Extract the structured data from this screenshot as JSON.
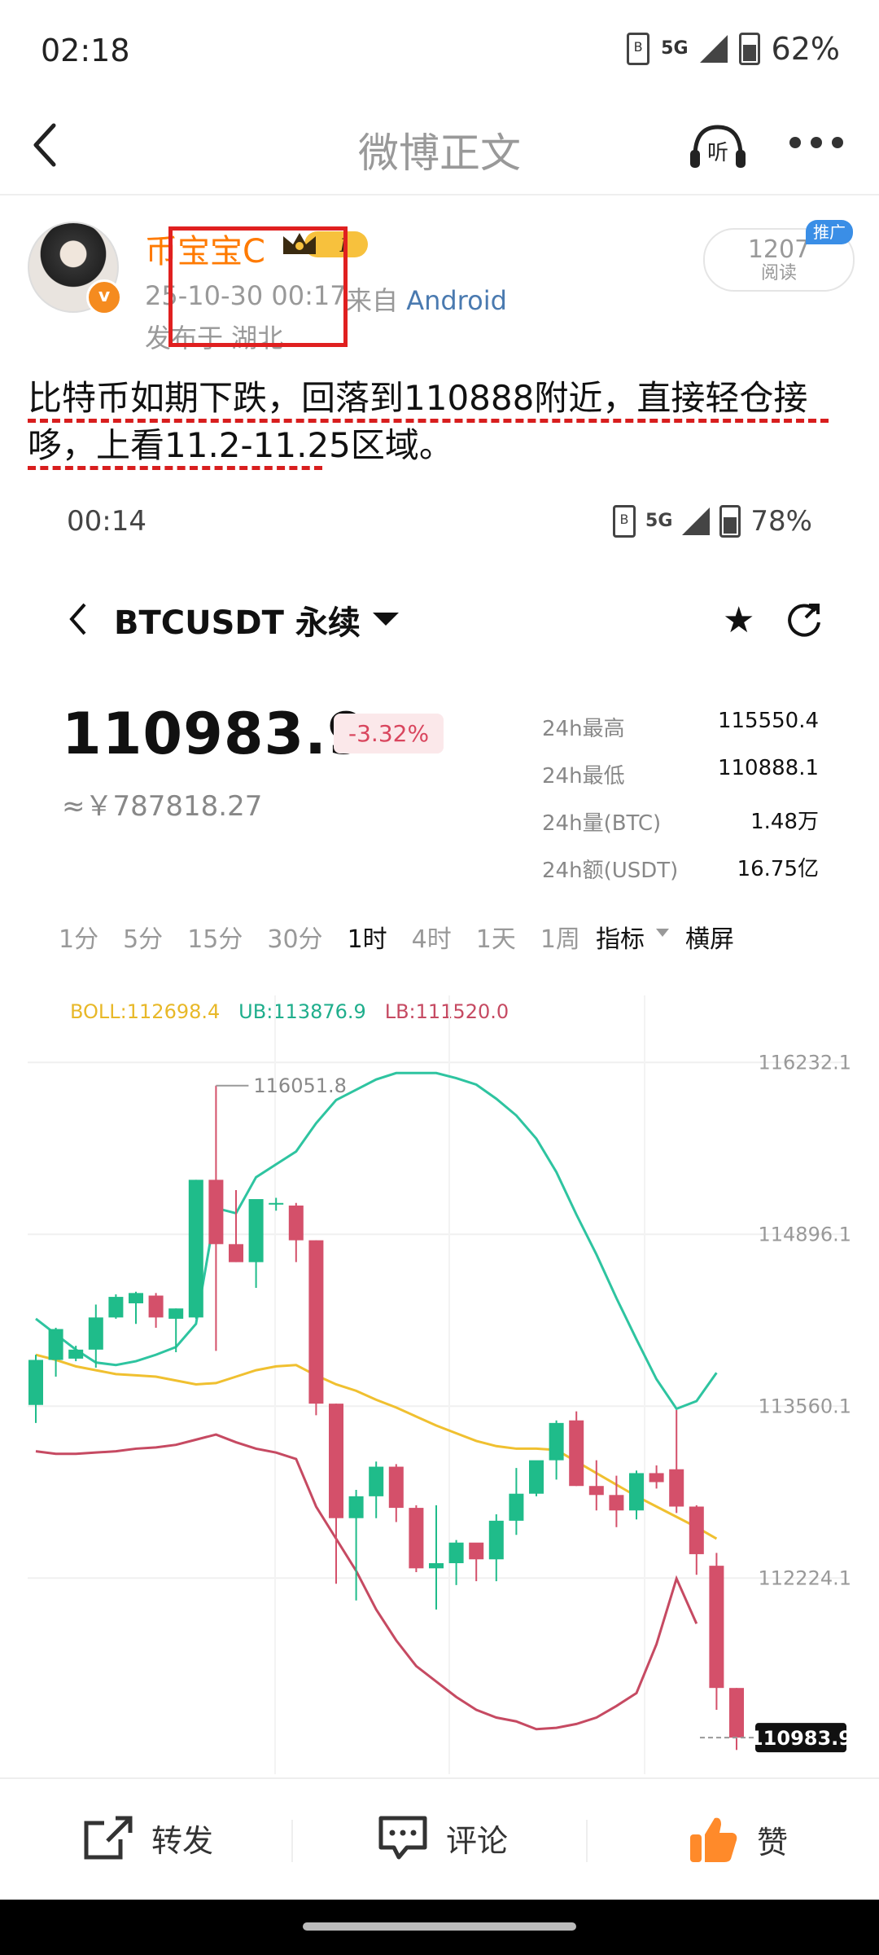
{
  "status": {
    "time": "02:18",
    "network": "5G",
    "battery": "62%"
  },
  "header": {
    "title": "微博正文"
  },
  "author": {
    "name": "币宝宝C",
    "date": "25-10-30 00:17",
    "source_prefix": "来自",
    "source": "Android",
    "location": "发布于 湖北",
    "reads": "1207",
    "reads_label": "阅读",
    "promo": "推广",
    "vip_level": "I"
  },
  "post": {
    "text": "比特币如期下跌，回落到110888附近，直接轻仓接哆，上看11.2-11.25区域。"
  },
  "embedded": {
    "status": {
      "time": "00:14",
      "network": "5G",
      "battery": "78%"
    },
    "symbol": "BTCUSDT 永续",
    "price": "110983.9",
    "change": "-3.32%",
    "cny": "≈￥787818.27",
    "stats": [
      {
        "label": "24h最高",
        "value": "115550.4"
      },
      {
        "label": "24h最低",
        "value": "110888.1"
      },
      {
        "label": "24h量(BTC)",
        "value": "1.48万"
      },
      {
        "label": "24h额(USDT)",
        "value": "16.75亿"
      }
    ],
    "periods": [
      "1分",
      "5分",
      "15分",
      "30分",
      "1时",
      "4时",
      "1天",
      "1周"
    ],
    "active_period": "1时",
    "indicator": "指标",
    "landscape": "横屏",
    "boll": {
      "boll": "BOLL:112698.4",
      "ub": "UB:113876.9",
      "lb": "LB:111520.0"
    }
  },
  "chart_data": {
    "type": "candlestick",
    "ylim": [
      110700,
      116500
    ],
    "y_ticks": [
      "116232.1",
      "114896.1",
      "113560.1",
      "112224.1"
    ],
    "y_tick_values": [
      116232.1,
      114896.1,
      113560.1,
      112224.1
    ],
    "high_annotation": "116051.8",
    "last_price_label": "110983.9",
    "colors": {
      "up": "#1fbc8a",
      "down": "#d4506a",
      "boll_mid": "#f0c030",
      "boll_upper": "#2ec4a0",
      "boll_lower": "#c64a62"
    },
    "candles": [
      {
        "o": 113570,
        "h": 113960,
        "c": 113920,
        "l": 113430
      },
      {
        "o": 113920,
        "h": 114170,
        "c": 114160,
        "l": 113790
      },
      {
        "o": 113930,
        "h": 114030,
        "c": 114000,
        "l": 113910
      },
      {
        "o": 114000,
        "h": 114350,
        "c": 114250,
        "l": 113860
      },
      {
        "o": 114250,
        "h": 114430,
        "c": 114410,
        "l": 114240
      },
      {
        "o": 114360,
        "h": 114450,
        "c": 114440,
        "l": 114200
      },
      {
        "o": 114420,
        "h": 114440,
        "c": 114250,
        "l": 114170
      },
      {
        "o": 114240,
        "h": 114320,
        "c": 114320,
        "l": 113980
      },
      {
        "o": 114250,
        "h": 115320,
        "c": 115320,
        "l": 114240
      },
      {
        "o": 115320,
        "h": 116051.8,
        "c": 114820,
        "l": 113990
      },
      {
        "o": 114820,
        "h": 115240,
        "c": 114680,
        "l": 114680
      },
      {
        "o": 114680,
        "h": 115120,
        "c": 115170,
        "l": 114480
      },
      {
        "o": 115140,
        "h": 115180,
        "c": 115140,
        "l": 115080
      },
      {
        "o": 115120,
        "h": 115140,
        "c": 114850,
        "l": 114680
      },
      {
        "o": 114850,
        "h": 114850,
        "c": 113580,
        "l": 113490
      },
      {
        "o": 113580,
        "h": 113580,
        "c": 112690,
        "l": 112180
      },
      {
        "o": 112690,
        "h": 112910,
        "c": 112860,
        "l": 112050
      },
      {
        "o": 112860,
        "h": 113130,
        "c": 113090,
        "l": 112690
      },
      {
        "o": 113090,
        "h": 113110,
        "c": 112770,
        "l": 112660
      },
      {
        "o": 112770,
        "h": 112790,
        "c": 112300,
        "l": 112270
      },
      {
        "o": 112300,
        "h": 112790,
        "c": 112340,
        "l": 111980
      },
      {
        "o": 112340,
        "h": 112520,
        "c": 112500,
        "l": 112170
      },
      {
        "o": 112500,
        "h": 112480,
        "c": 112370,
        "l": 112200
      },
      {
        "o": 112370,
        "h": 112720,
        "c": 112670,
        "l": 112200
      },
      {
        "o": 112670,
        "h": 113080,
        "c": 112880,
        "l": 112560
      },
      {
        "o": 112880,
        "h": 113120,
        "c": 113140,
        "l": 112860
      },
      {
        "o": 113140,
        "h": 113450,
        "c": 113430,
        "l": 112990
      },
      {
        "o": 113450,
        "h": 113520,
        "c": 112940,
        "l": 112940
      },
      {
        "o": 112940,
        "h": 113140,
        "c": 112870,
        "l": 112750
      },
      {
        "o": 112870,
        "h": 113020,
        "c": 112750,
        "l": 112620
      },
      {
        "o": 112750,
        "h": 113060,
        "c": 113040,
        "l": 112680
      },
      {
        "o": 113040,
        "h": 113100,
        "c": 112970,
        "l": 112920
      },
      {
        "o": 113070,
        "h": 113530,
        "c": 112780,
        "l": 112730
      },
      {
        "o": 112780,
        "h": 112790,
        "c": 112410,
        "l": 112250
      },
      {
        "o": 112320,
        "h": 112420,
        "c": 111370,
        "l": 111200
      },
      {
        "o": 111370,
        "h": 111370,
        "c": 110983.9,
        "l": 110888.1
      }
    ],
    "boll_upper": [
      114240,
      114120,
      114000,
      113900,
      113880,
      113910,
      113960,
      114020,
      114200,
      115100,
      115060,
      115340,
      115440,
      115540,
      115760,
      115940,
      116020,
      116100,
      116150,
      116150,
      116150,
      116110,
      116060,
      115950,
      115820,
      115640,
      115380,
      115050,
      114740,
      114400,
      114080,
      113770,
      113540,
      113600,
      113820
    ],
    "boll_mid": [
      113960,
      113920,
      113870,
      113840,
      113810,
      113800,
      113790,
      113760,
      113730,
      113740,
      113790,
      113840,
      113870,
      113880,
      113800,
      113730,
      113680,
      113610,
      113550,
      113480,
      113410,
      113350,
      113290,
      113250,
      113230,
      113230,
      113220,
      113130,
      113040,
      112950,
      112860,
      112780,
      112700,
      112620,
      112530
    ],
    "boll_lower": [
      113210,
      113190,
      113190,
      113200,
      113210,
      113230,
      113240,
      113260,
      113300,
      113340,
      113280,
      113230,
      113200,
      113150,
      112780,
      112530,
      112280,
      111980,
      111740,
      111540,
      111420,
      111300,
      111200,
      111140,
      111110,
      111050,
      111060,
      111090,
      111140,
      111230,
      111330,
      111710,
      112220,
      111870
    ]
  },
  "actions": {
    "repost": "转发",
    "comment": "评论",
    "like": "赞"
  }
}
